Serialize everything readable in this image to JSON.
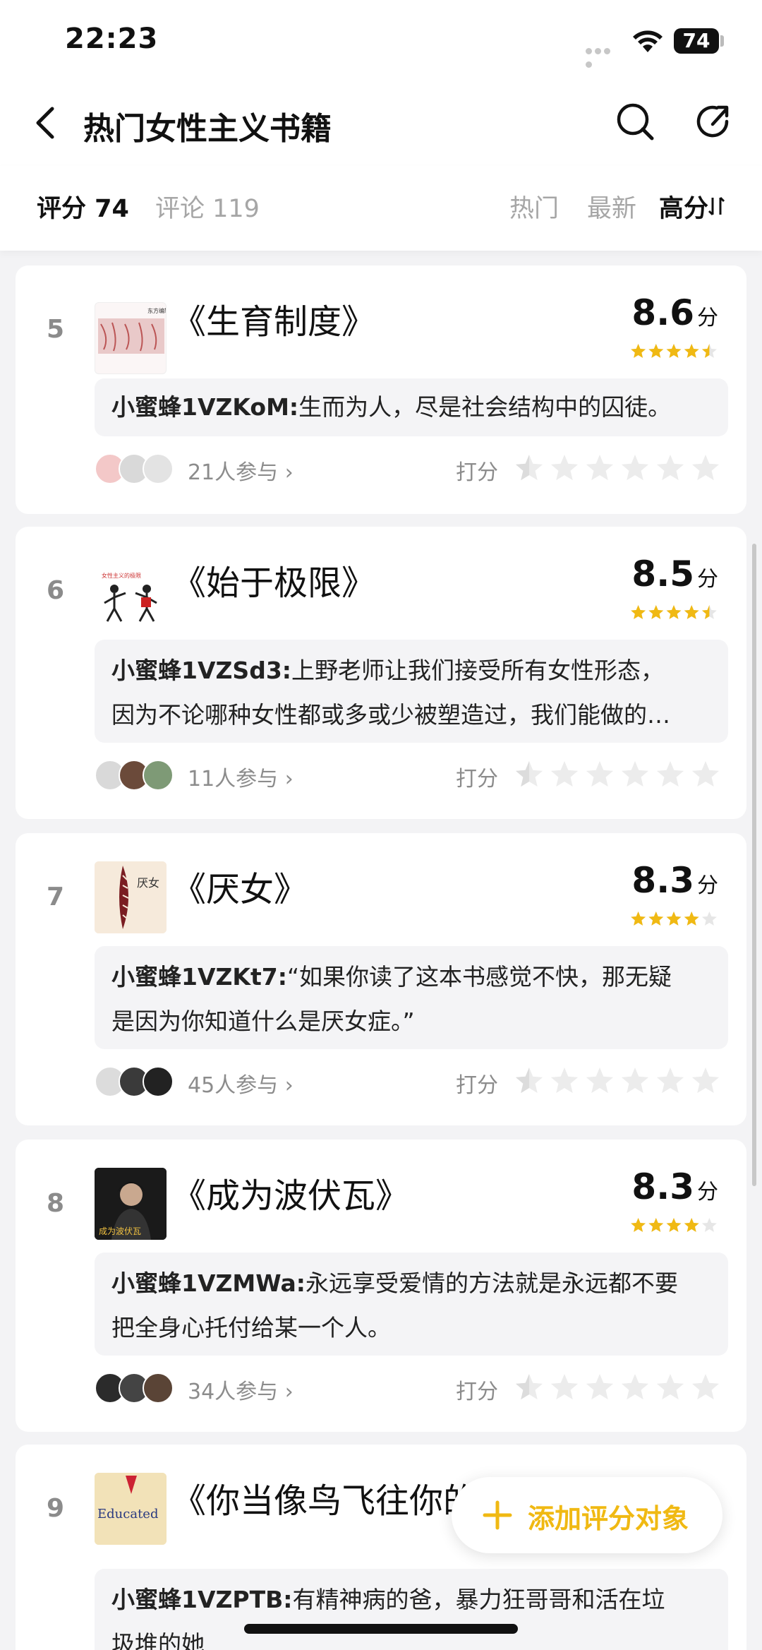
{
  "status_bar": {
    "time": "22:23",
    "battery": "74"
  },
  "header": {
    "title": "热门女性主义书籍"
  },
  "tabs": {
    "rating": "评分 74",
    "comments": "评论 119",
    "sort": {
      "hot": "热门",
      "latest": "最新",
      "high": "高分"
    }
  },
  "colors": {
    "accent": "#f0b913",
    "star_empty": "#e6e6e6",
    "quote_bg": "#f4f4f6"
  },
  "common": {
    "rate_label": "打分",
    "score_unit": "分"
  },
  "books": [
    {
      "rank": "5",
      "title": "《生育制度》",
      "score": "8.6",
      "stars": 4.5,
      "user": "小蜜蜂1VZKoM:",
      "quote": "生而为人，尽是社会结构中的囚徒。",
      "quote2": "",
      "participants": "21人参与 ›"
    },
    {
      "rank": "6",
      "title": "《始于极限》",
      "score": "8.5",
      "stars": 4.5,
      "user": "小蜜蜂1VZSd3:",
      "quote": "上野老师让我们接受所有女性形态，",
      "quote2": "因为不论哪种女性都或多或少被塑造过，我们能做的…",
      "participants": "11人参与 ›"
    },
    {
      "rank": "7",
      "title": "《厌女》",
      "score": "8.3",
      "stars": 4,
      "user": "小蜜蜂1VZKt7:",
      "quote": "“如果你读了这本书感觉不快，那无疑",
      "quote2": "是因为你知道什么是厌女症。”",
      "participants": "45人参与 ›"
    },
    {
      "rank": "8",
      "title": "《成为波伏瓦》",
      "score": "8.3",
      "stars": 4,
      "user": "小蜜蜂1VZMWa:",
      "quote": "永远享受爱情的方法就是永远都不要",
      "quote2": "把全身心托付给某一个人。",
      "participants": "34人参与 ›"
    },
    {
      "rank": "9",
      "title": "《你当像鸟飞往你的",
      "user": "小蜜蜂1VZPTB:",
      "quote": "有精神病的爸，暴力狂哥哥和活在垃",
      "quote2": "圾堆的她"
    }
  ],
  "covers": {
    "c5": "东方编辑",
    "c6": "女性主义的极限",
    "c7": "厌女",
    "c8": "成为波伏瓦",
    "c9": "Educated"
  },
  "fab": {
    "label": "添加评分对象"
  }
}
